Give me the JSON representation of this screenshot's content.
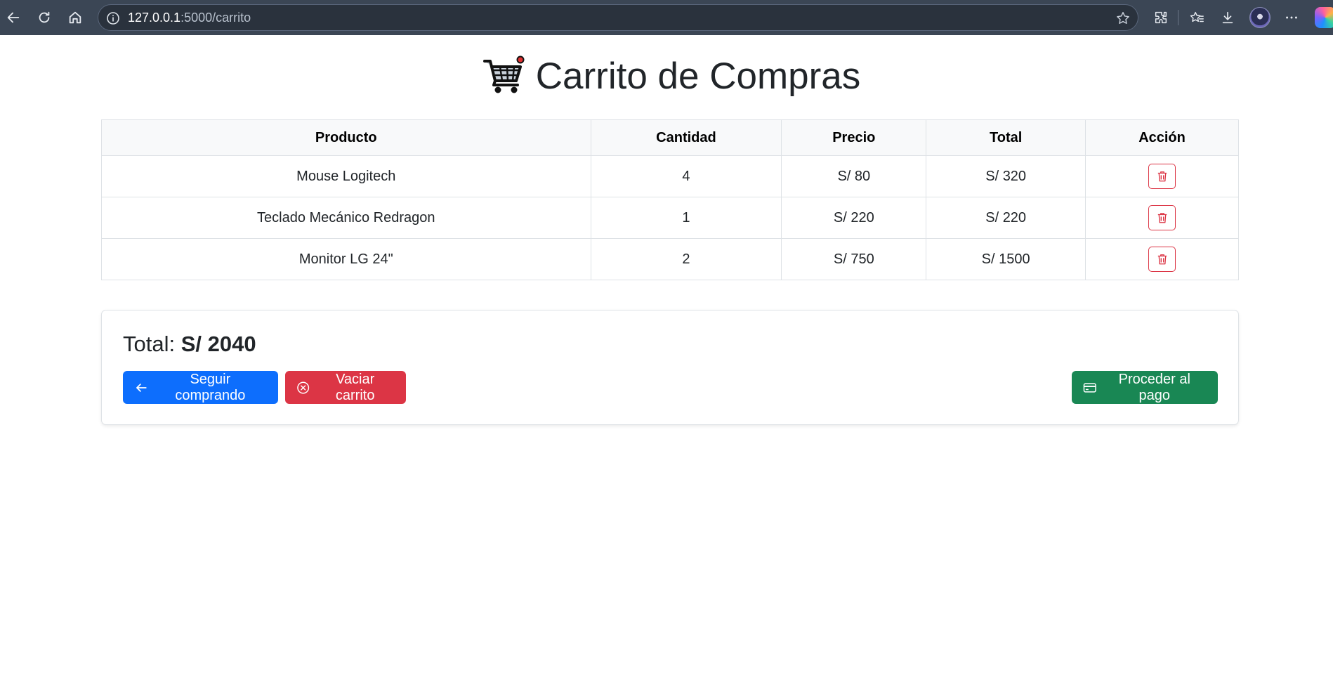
{
  "browser": {
    "url_host": "127.0.0.1",
    "url_path": ":5000/carrito"
  },
  "page": {
    "title": "Carrito de Compras",
    "title_icon": "shopping-cart-icon"
  },
  "table": {
    "headers": [
      "Producto",
      "Cantidad",
      "Precio",
      "Total",
      "Acción"
    ],
    "rows": [
      {
        "producto": "Mouse Logitech",
        "cantidad": "4",
        "precio": "S/ 80",
        "total": "S/ 320"
      },
      {
        "producto": "Teclado Mecánico Redragon",
        "cantidad": "1",
        "precio": "S/ 220",
        "total": "S/ 220"
      },
      {
        "producto": "Monitor LG 24\"",
        "cantidad": "2",
        "precio": "S/ 750",
        "total": "S/ 1500"
      }
    ],
    "action_icon": "trash-icon"
  },
  "summary": {
    "total_label": "Total:",
    "total_value": "S/ 2040",
    "buttons": {
      "continue": "Seguir comprando",
      "empty": "Vaciar carrito",
      "checkout": "Proceder al pago"
    }
  },
  "colors": {
    "primary": "#0d6efd",
    "danger": "#dc3545",
    "success": "#198754",
    "browser_bar": "#3b4655"
  }
}
